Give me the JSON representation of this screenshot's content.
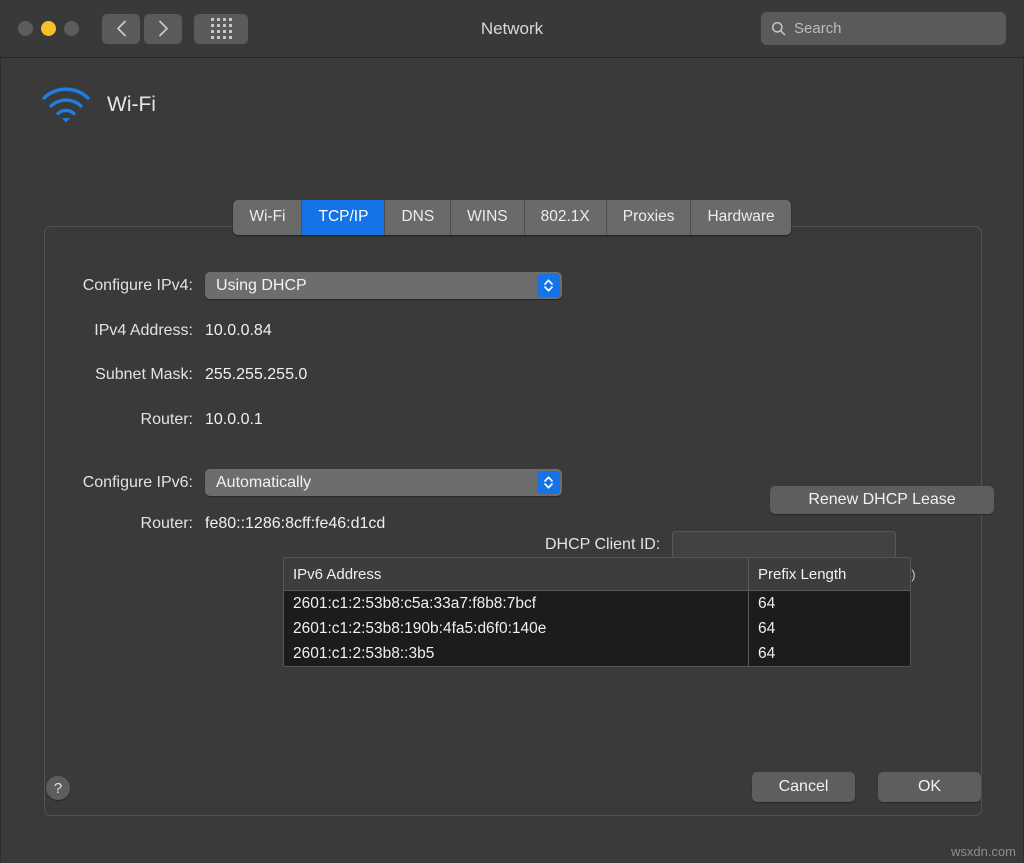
{
  "window": {
    "title": "Network",
    "traffic_lights": [
      "close",
      "minimize",
      "zoom"
    ]
  },
  "toolbar": {
    "back_icon": "chevron-left-icon",
    "forward_icon": "chevron-right-icon",
    "grid_icon": "show-all-grid-icon",
    "search": {
      "icon": "search-icon",
      "placeholder": "Search",
      "value": ""
    }
  },
  "service": {
    "icon": "wifi-icon",
    "name": "Wi-Fi",
    "icon_color": "#1d7fe0"
  },
  "tabs": [
    {
      "label": "Wi-Fi",
      "active": false
    },
    {
      "label": "TCP/IP",
      "active": true
    },
    {
      "label": "DNS",
      "active": false
    },
    {
      "label": "WINS",
      "active": false
    },
    {
      "label": "802.1X",
      "active": false
    },
    {
      "label": "Proxies",
      "active": false
    },
    {
      "label": "Hardware",
      "active": false
    }
  ],
  "accent_color": "#1473e6",
  "ipv4": {
    "configure_label": "Configure IPv4:",
    "configure_value": "Using DHCP",
    "address_label": "IPv4 Address:",
    "address_value": "10.0.0.84",
    "subnet_label": "Subnet Mask:",
    "subnet_value": "255.255.255.0",
    "router_label": "Router:",
    "router_value": "10.0.0.1",
    "renew_button": "Renew DHCP Lease",
    "client_id_label": "DHCP Client ID:",
    "client_id_value": "",
    "client_id_hint": "(If required)"
  },
  "ipv6": {
    "configure_label": "Configure IPv6:",
    "configure_value": "Automatically",
    "router_label": "Router:",
    "router_value": "fe80::1286:8cff:fe46:d1cd",
    "table": {
      "columns": [
        "IPv6 Address",
        "Prefix Length"
      ],
      "rows": [
        [
          "2601:c1:2:53b8:c5a:33a7:f8b8:7bcf",
          "64"
        ],
        [
          "2601:c1:2:53b8:190b:4fa5:d6f0:140e",
          "64"
        ],
        [
          "2601:c1:2:53b8::3b5",
          "64"
        ]
      ]
    }
  },
  "footer": {
    "help_label": "?",
    "cancel_label": "Cancel",
    "ok_label": "OK"
  },
  "watermark": "wsxdn.com"
}
